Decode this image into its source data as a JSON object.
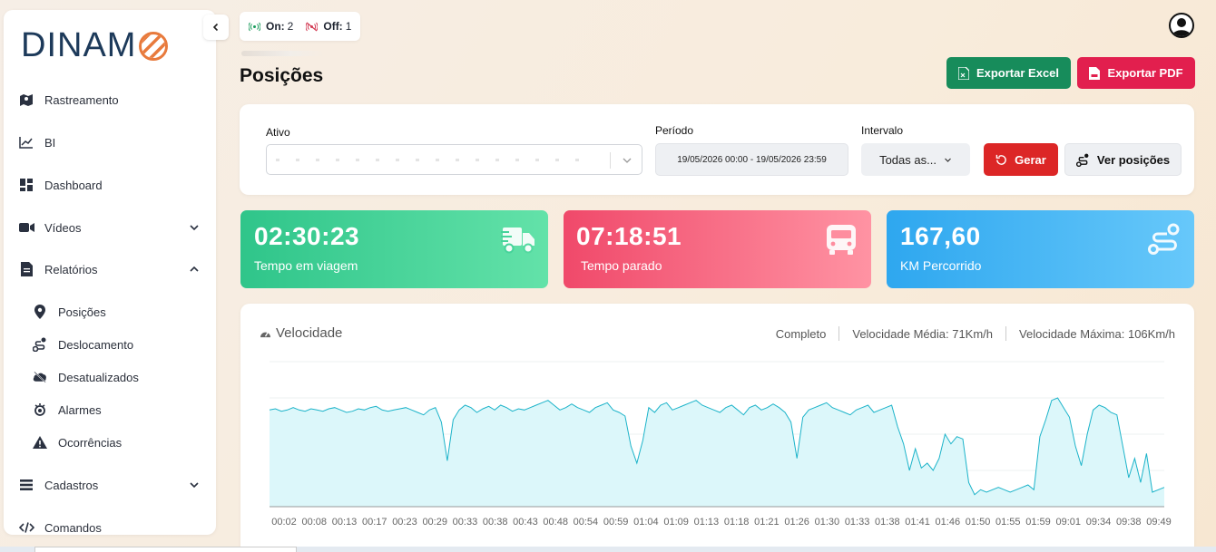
{
  "sidebar": {
    "logo_text": "DINAM",
    "items": [
      {
        "label": "Rastreamento"
      },
      {
        "label": "BI"
      },
      {
        "label": "Dashboard"
      },
      {
        "label": "Vídeos"
      },
      {
        "label": "Relatórios"
      },
      {
        "label": "Cadastros"
      },
      {
        "label": "Comandos"
      }
    ],
    "sub_items": [
      {
        "label": "Posições"
      },
      {
        "label": "Deslocamento"
      },
      {
        "label": "Desatualizados"
      },
      {
        "label": "Alarmes"
      },
      {
        "label": "Ocorrências"
      }
    ]
  },
  "status": {
    "on_label": "On:",
    "on_count": "2",
    "off_label": "Off:",
    "off_count": "1"
  },
  "page": {
    "title": "Posições"
  },
  "toolbar": {
    "excel_label": "Exportar Excel",
    "pdf_label": "Exportar PDF"
  },
  "filters": {
    "ativo_label": "Ativo",
    "periodo_label": "Período",
    "periodo_value": "19/05/2026 00:00 - 19/05/2026 23:59",
    "intervalo_label": "Intervalo",
    "intervalo_value": "Todas as...",
    "gerar_label": "Gerar",
    "ver_label": "Ver posições"
  },
  "stats": [
    {
      "value": "02:30:23",
      "label": "Tempo em viagem",
      "icon": "truck-icon"
    },
    {
      "value": "07:18:51",
      "label": "Tempo parado",
      "icon": "bus-icon"
    },
    {
      "value": "167,60",
      "label": "KM Percorrido",
      "icon": "route-icon"
    }
  ],
  "colors": {
    "accent_green": "#178c5b",
    "accent_red": "#e21f4e",
    "chart_line": "#1bb3c9",
    "chart_fill": "#dcf7fa"
  },
  "chart_header": {
    "title": "Velocidade",
    "mode": "Completo",
    "avg": "Velocidade Média: 71Km/h",
    "max": "Velocidade Máxima: 106Km/h"
  },
  "chart_data": {
    "type": "area",
    "title": "Velocidade",
    "x_ticks": [
      "00:02",
      "00:08",
      "00:13",
      "00:17",
      "00:23",
      "00:29",
      "00:33",
      "00:38",
      "00:43",
      "00:48",
      "00:54",
      "00:59",
      "01:04",
      "01:09",
      "01:13",
      "01:18",
      "01:21",
      "01:26",
      "01:30",
      "01:33",
      "01:38",
      "01:41",
      "01:46",
      "01:50",
      "01:55",
      "01:59",
      "09:01",
      "09:34",
      "09:38",
      "09:49"
    ],
    "ylim": [
      0,
      120
    ],
    "series": [
      {
        "values": [
          80,
          81,
          79,
          80,
          82,
          80,
          79,
          81,
          80,
          79,
          81,
          82,
          80,
          78,
          79,
          81,
          80,
          82,
          83,
          80,
          79,
          80,
          81,
          82,
          80,
          78,
          76,
          80,
          82,
          70,
          38,
          72,
          80,
          84,
          82,
          78,
          81,
          83,
          80,
          84,
          82,
          79,
          81,
          80,
          82,
          84,
          86,
          88,
          84,
          80,
          82,
          85,
          82,
          80,
          78,
          82,
          84,
          86,
          80,
          78,
          75,
          50,
          36,
          55,
          82,
          78,
          84,
          86,
          80,
          82,
          84,
          86,
          88,
          84,
          82,
          80,
          78,
          82,
          84,
          80,
          76,
          82,
          84,
          80,
          82,
          85,
          82,
          78,
          70,
          40,
          74,
          80,
          82,
          84,
          86,
          82,
          80,
          78,
          76,
          80,
          82,
          84,
          78,
          80,
          82,
          84,
          66,
          52,
          30,
          48,
          32,
          36,
          30,
          40,
          60,
          52,
          58,
          56,
          20,
          10,
          14,
          12,
          14,
          16,
          14,
          12,
          14,
          16,
          18,
          14,
          58,
          72,
          88,
          90,
          82,
          74,
          50,
          34,
          60,
          80,
          84,
          82,
          78,
          76,
          50,
          24,
          40,
          20,
          44,
          12,
          14,
          16
        ]
      }
    ]
  }
}
